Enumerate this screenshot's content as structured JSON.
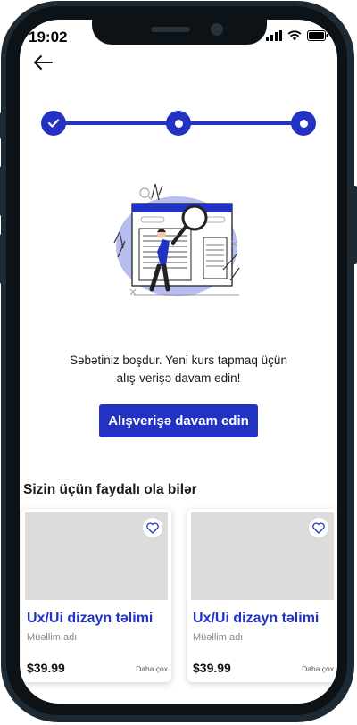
{
  "status_bar": {
    "time": "19:02",
    "icons": [
      "signal-icon",
      "wifi-icon",
      "battery-icon"
    ]
  },
  "header": {
    "back_icon": "arrow-left-icon"
  },
  "stepper": {
    "steps_total": 3,
    "steps": [
      "completed",
      "current",
      "current"
    ],
    "accent": "#2233c4"
  },
  "empty_state": {
    "message_line1": "Səbətiniz boşdur. Yeni kurs tapmaq üçün",
    "message_line2": "alış-verişə davam edin!",
    "button_label": "Alışverişə davam edin"
  },
  "recommendations": {
    "title": "Sizin üçün faydalı ola bilər",
    "cards": [
      {
        "title": "Ux/Ui dizayn təlimi",
        "teacher": "Müəllim adı",
        "price": "$39.99",
        "more": "Daha çox",
        "fav_icon": "heart-outline-icon"
      },
      {
        "title": "Ux/Ui dizayn təlimi",
        "teacher": "Müəllim adı",
        "price": "$39.99",
        "more": "Daha çox",
        "fav_icon": "heart-outline-icon"
      }
    ]
  },
  "colors": {
    "primary": "#2233c4",
    "placeholder": "#dcdcdc",
    "frame": "#1e2a33"
  }
}
